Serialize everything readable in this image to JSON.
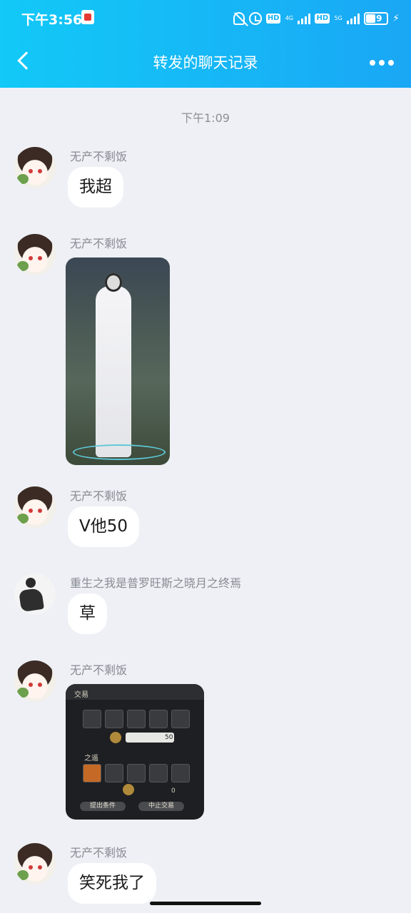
{
  "status_bar": {
    "time": "下午3:56",
    "hd1": "HD",
    "net1": "4G",
    "hd2": "HD",
    "net2": "5G",
    "battery": "39"
  },
  "nav": {
    "title": "转发的聊天记录"
  },
  "chat": {
    "time_separator": "下午1:09",
    "messages": [
      {
        "sender": "无产不剩饭",
        "text": "我超"
      },
      {
        "sender": "无产不剩饭",
        "image": "character-screenshot"
      },
      {
        "sender": "无产不剩饭",
        "text": "V他50"
      },
      {
        "sender": "重生之我是普罗旺斯之晓月之终焉",
        "text": "草"
      },
      {
        "sender": "无产不剩饭",
        "image": "trade-window-screenshot",
        "trade": {
          "title": "交易",
          "gil": "50",
          "section": "之遥",
          "zero": "0",
          "button_left": "提出条件",
          "button_right": "中止交易"
        }
      },
      {
        "sender": "无产不剩饭",
        "text": "笑死我了"
      }
    ]
  }
}
